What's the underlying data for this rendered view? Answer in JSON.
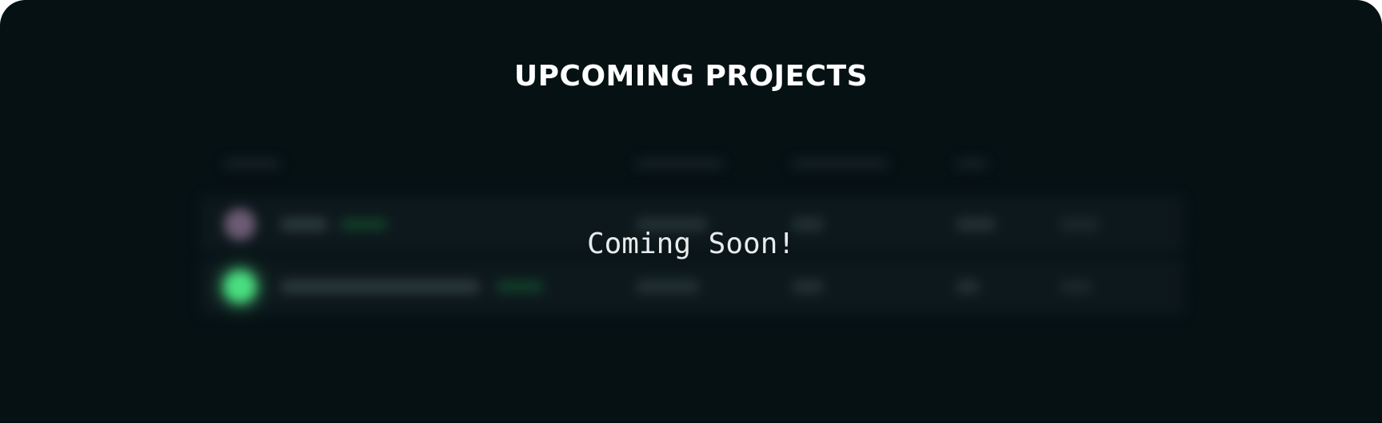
{
  "section": {
    "title": "UPCOMING PROJECTS",
    "overlay_text": "Coming Soon!"
  },
  "colors": {
    "background": "#061114",
    "title_text": "#ffffff",
    "overlay_text": "#e9ecec",
    "accent_green": "#4ade80",
    "avatar_purple": "#6b5b73"
  }
}
